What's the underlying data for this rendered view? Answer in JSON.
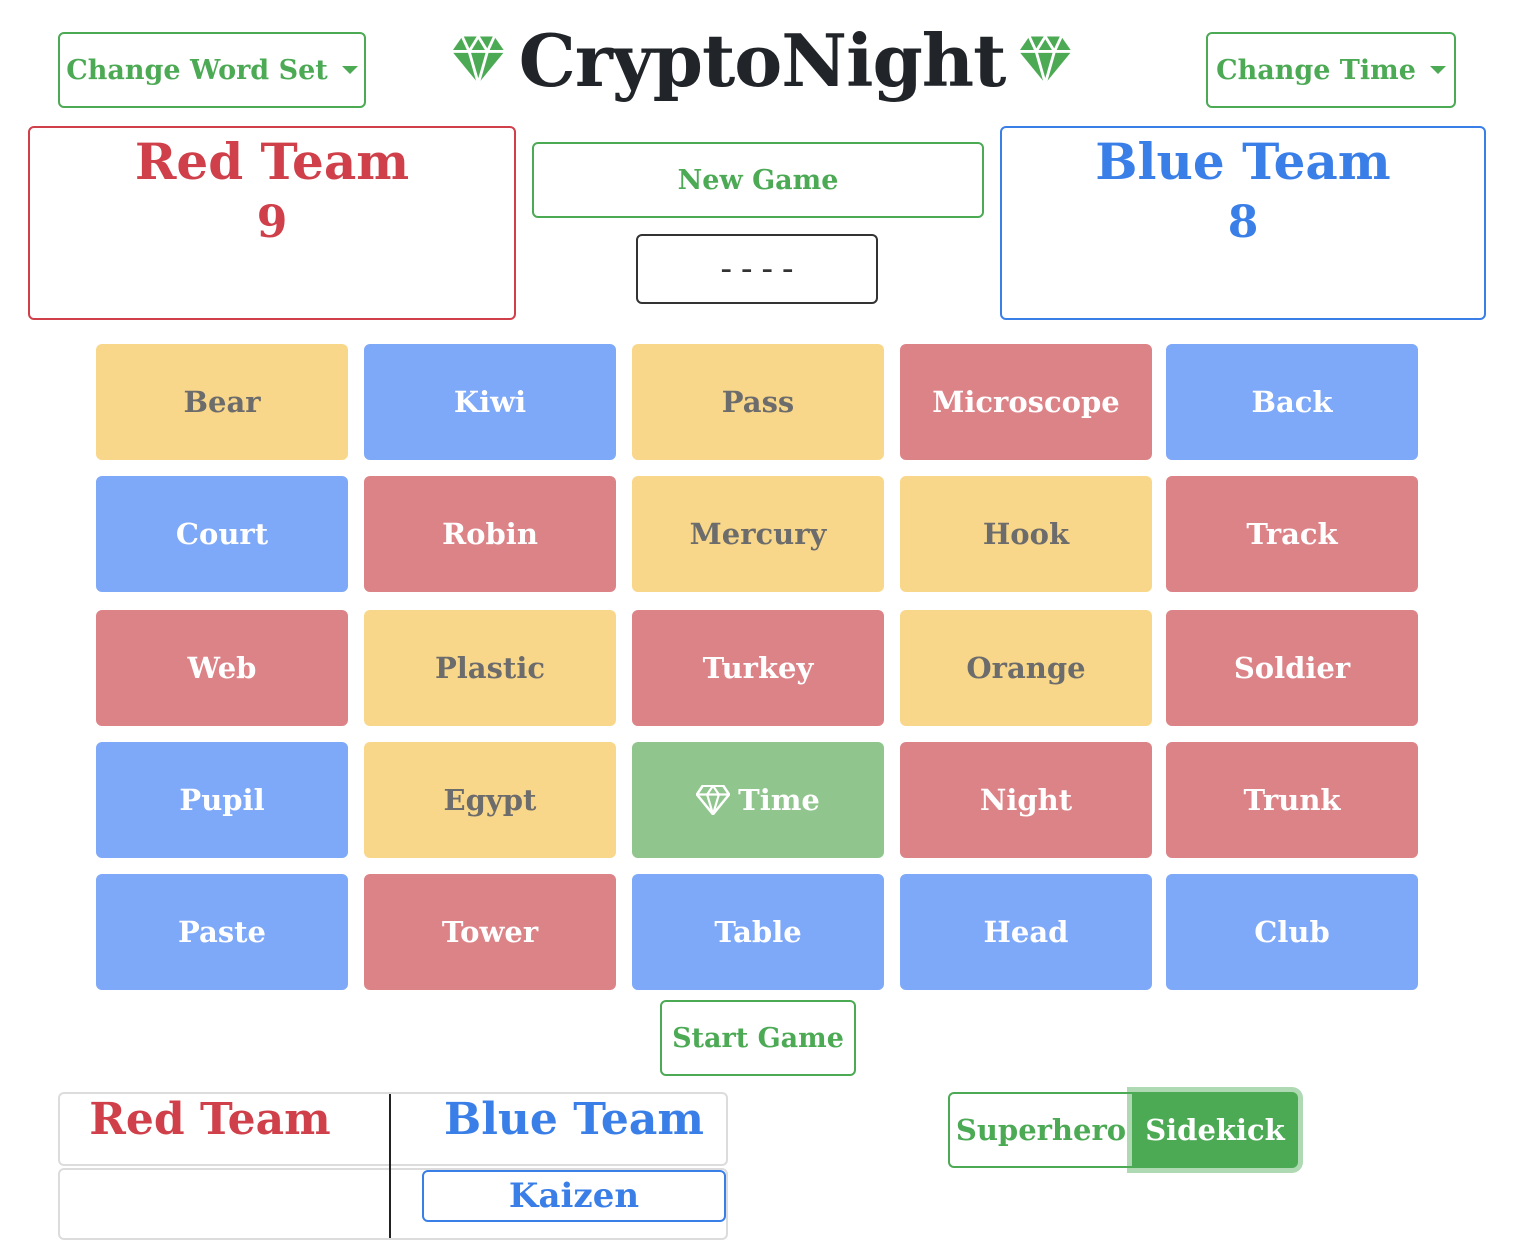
{
  "header": {
    "word_set_label": "Change Word Set",
    "title": "CryptoNight",
    "time_label": "Change Time"
  },
  "scoreboard": {
    "red": {
      "name": "Red Team",
      "score": "9"
    },
    "blue": {
      "name": "Blue Team",
      "score": "8"
    },
    "new_game_label": "New Game",
    "timer": "----"
  },
  "board": {
    "cards": [
      {
        "word": "Bear",
        "color": "yellow"
      },
      {
        "word": "Kiwi",
        "color": "blue"
      },
      {
        "word": "Pass",
        "color": "yellow"
      },
      {
        "word": "Microscope",
        "color": "red"
      },
      {
        "word": "Back",
        "color": "blue"
      },
      {
        "word": "Court",
        "color": "blue"
      },
      {
        "word": "Robin",
        "color": "red"
      },
      {
        "word": "Mercury",
        "color": "yellow"
      },
      {
        "word": "Hook",
        "color": "yellow"
      },
      {
        "word": "Track",
        "color": "red"
      },
      {
        "word": "Web",
        "color": "red"
      },
      {
        "word": "Plastic",
        "color": "yellow"
      },
      {
        "word": "Turkey",
        "color": "red"
      },
      {
        "word": "Orange",
        "color": "yellow"
      },
      {
        "word": "Soldier",
        "color": "red"
      },
      {
        "word": "Pupil",
        "color": "blue"
      },
      {
        "word": "Egypt",
        "color": "yellow"
      },
      {
        "word": "Time",
        "color": "green",
        "icon": "gem-icon"
      },
      {
        "word": "Night",
        "color": "red"
      },
      {
        "word": "Trunk",
        "color": "red"
      },
      {
        "word": "Paste",
        "color": "blue"
      },
      {
        "word": "Tower",
        "color": "red"
      },
      {
        "word": "Table",
        "color": "blue"
      },
      {
        "word": "Head",
        "color": "blue"
      },
      {
        "word": "Club",
        "color": "blue"
      }
    ],
    "start_label": "Start Game"
  },
  "roster": {
    "red_header": "Red Team",
    "blue_header": "Blue Team",
    "blue_players": [
      "Kaizen"
    ]
  },
  "roles": {
    "superhero_label": "Superhero",
    "sidekick_label": "Sidekick",
    "selected": "Sidekick"
  },
  "colors": {
    "accent_green": "#4caa55",
    "red_team": "#d0404a",
    "blue_team": "#3a7fe8",
    "card_yellow": "#f9d78a",
    "card_blue": "#7ea8f8",
    "card_red": "#dc8388",
    "card_green": "#91c58e"
  }
}
